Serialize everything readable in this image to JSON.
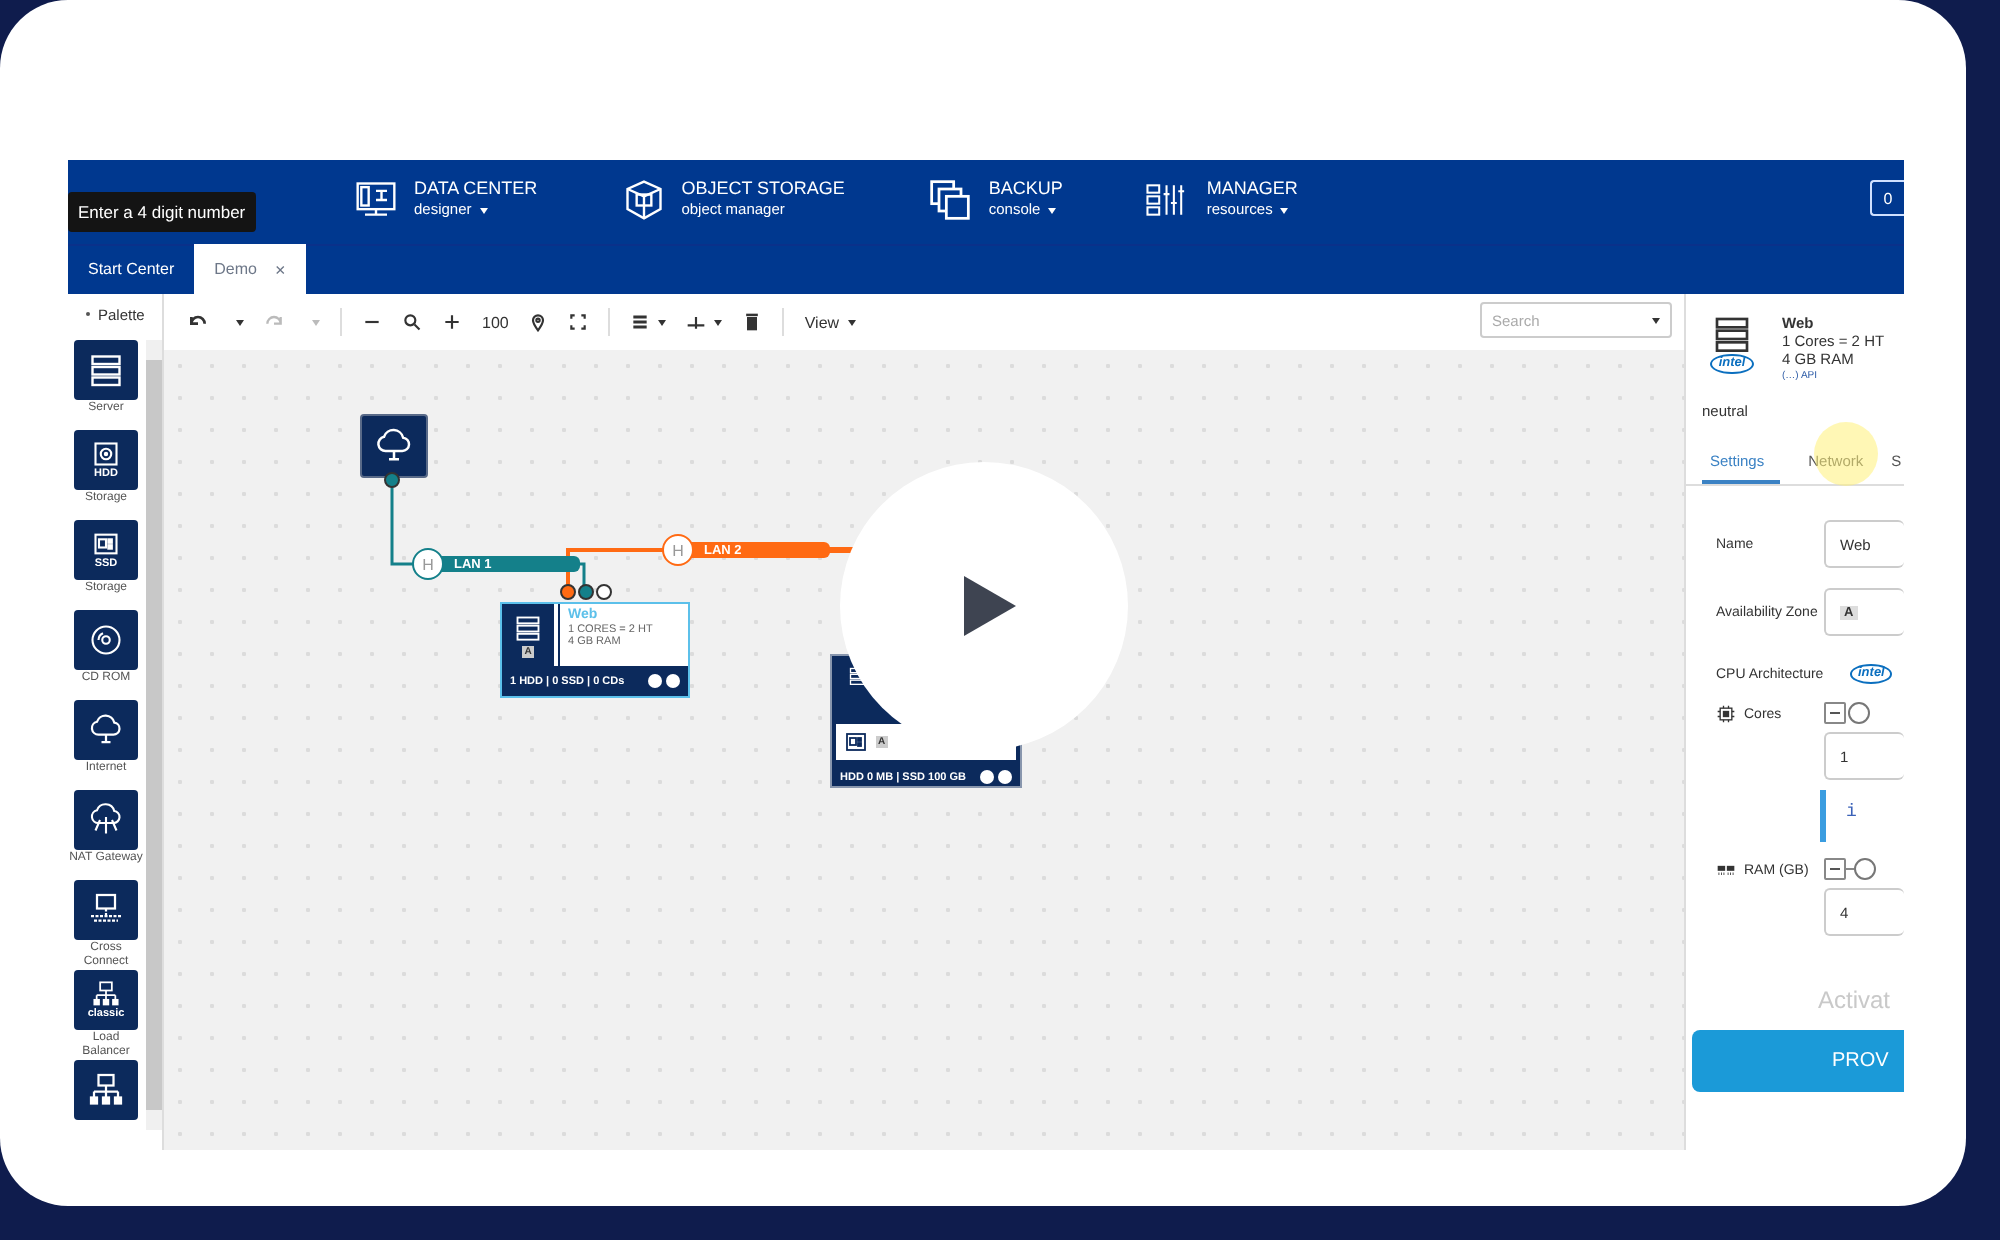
{
  "tooltip": "Enter a 4 digit number",
  "header": {
    "nav": [
      {
        "title": "DATA CENTER",
        "subtitle": "designer",
        "dropdown": true
      },
      {
        "title": "OBJECT STORAGE",
        "subtitle": "object manager",
        "dropdown": false
      },
      {
        "title": "BACKUP",
        "subtitle": "console",
        "dropdown": true
      },
      {
        "title": "MANAGER",
        "subtitle": "resources",
        "dropdown": true
      }
    ],
    "counter": "0"
  },
  "tabs": [
    {
      "label": "Start Center",
      "selected": false
    },
    {
      "label": "Demo",
      "selected": true,
      "close": "×"
    }
  ],
  "palette": {
    "title": "Palette",
    "items": [
      {
        "label": "Server",
        "kind": "server"
      },
      {
        "label": "Storage",
        "badge": "HDD",
        "kind": "hdd"
      },
      {
        "label": "Storage",
        "badge": "SSD",
        "kind": "ssd"
      },
      {
        "label": "CD ROM",
        "kind": "cd"
      },
      {
        "label": "Internet",
        "kind": "cloud"
      },
      {
        "label": "NAT Gateway",
        "kind": "nat"
      },
      {
        "label": "Cross Connect",
        "kind": "cross"
      },
      {
        "label": "Load Balancer",
        "badge": "classic",
        "kind": "lb"
      },
      {
        "kind": "lb"
      }
    ]
  },
  "toolbar": {
    "undo": {
      "disabled": false
    },
    "redo": {
      "disabled": true
    },
    "zoom": "100",
    "view": "View",
    "search": {
      "placeholder": "Search"
    }
  },
  "canvas": {
    "lans": [
      {
        "label": "LAN 1",
        "hub": "H",
        "color": "#14808a"
      },
      {
        "label": "LAN 2",
        "hub": "H",
        "color": "#ff6a13"
      }
    ],
    "server": {
      "name": "Web",
      "selected": true,
      "zone": "A",
      "specs": [
        "1 CORES = 2 HT",
        "4 GB RAM"
      ],
      "footer": "1 HDD | 0 SSD | 0 CDs"
    },
    "storage_server": {
      "zone": "A",
      "footer": "HDD 0 MB | SSD 100 GB"
    }
  },
  "details": {
    "name": "Web",
    "specs": [
      "1 Cores = 2 HT",
      "4 GB RAM"
    ],
    "vendor": "intel",
    "api": "(…) API",
    "status": "neutral",
    "tabs": [
      {
        "label": "Settings",
        "selected": true
      },
      {
        "label": "Network",
        "selected": false
      },
      {
        "label": "S",
        "selected": false
      }
    ],
    "fields": [
      {
        "kind": "text",
        "label": "Name",
        "value": "Web"
      },
      {
        "kind": "zone",
        "label": "Availability Zone",
        "value": "A"
      },
      {
        "kind": "vendor",
        "label": "CPU Architecture",
        "value": "intel"
      },
      {
        "kind": "cores",
        "label": "Cores",
        "value": "1"
      },
      {
        "kind": "info",
        "text": "i"
      },
      {
        "kind": "ram",
        "label": "RAM (GB)",
        "value": "4"
      }
    ],
    "watermark": "Activat",
    "provision": "PROV"
  }
}
